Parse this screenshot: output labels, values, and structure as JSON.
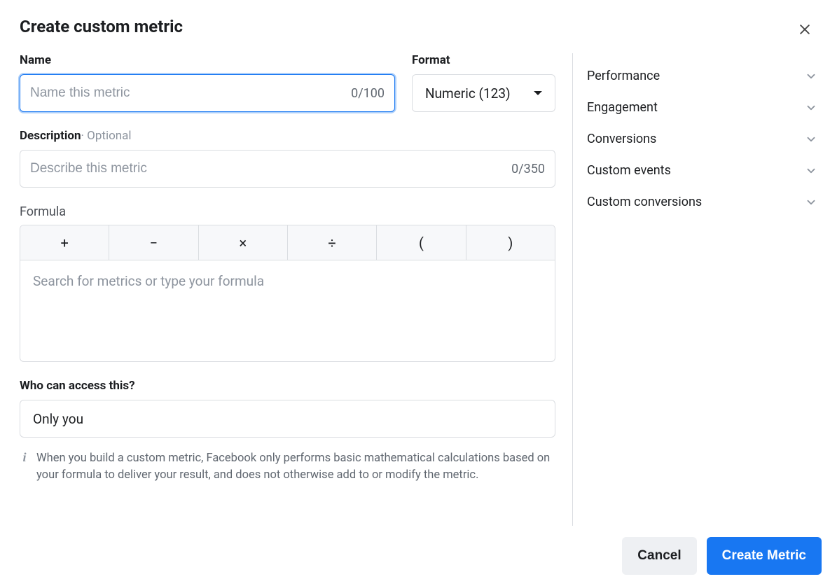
{
  "modal_title": "Create custom metric",
  "name_section": {
    "label": "Name",
    "placeholder": "Name this metric",
    "value": "",
    "counter": "0/100"
  },
  "format_section": {
    "label": "Format",
    "selected": "Numeric (123)"
  },
  "description_section": {
    "label": "Description",
    "optional_suffix": " · Optional",
    "placeholder": "Describe this metric",
    "value": "",
    "counter": "0/350"
  },
  "formula_section": {
    "label": "Formula",
    "operators": [
      "+",
      "−",
      "×",
      "÷",
      "(",
      ")"
    ],
    "placeholder": "Search for metrics or type your formula",
    "value": ""
  },
  "access_section": {
    "label": "Who can access this?",
    "selected": "Only you"
  },
  "info_text": "When you build a custom metric, Facebook only performs basic mathematical calculations based on your formula to deliver your result, and does not otherwise add to or modify the metric.",
  "sidebar_categories": [
    "Performance",
    "Engagement",
    "Conversions",
    "Custom events",
    "Custom conversions"
  ],
  "footer": {
    "cancel": "Cancel",
    "create": "Create Metric"
  }
}
